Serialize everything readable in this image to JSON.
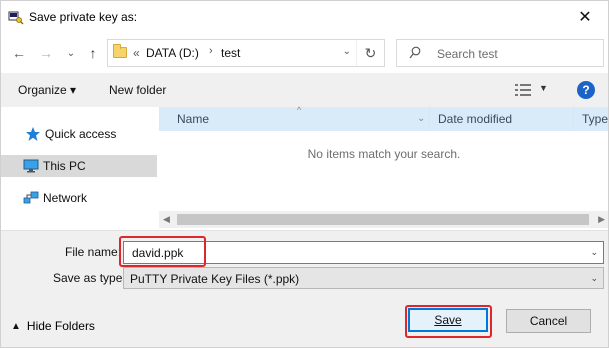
{
  "window": {
    "title": "Save private key as:",
    "close_glyph": "✕"
  },
  "nav": {
    "back_glyph": "←",
    "forward_glyph": "→",
    "recent_glyph": "⌄",
    "up_glyph": "↑"
  },
  "address": {
    "overflow": "«",
    "drive": "DATA (D:)",
    "separator": "›",
    "folder": "test",
    "dropdown_glyph": "⌄",
    "refresh_glyph": "↻"
  },
  "search": {
    "placeholder": "Search test"
  },
  "toolbar": {
    "organize_label": "Organize ▾",
    "new_folder_label": "New folder",
    "view_caret": "▼",
    "help_label": "?"
  },
  "sidebar": {
    "items": [
      {
        "label": "Quick access",
        "icon": "star-icon"
      },
      {
        "label": "This PC",
        "icon": "computer-icon",
        "selected": true
      },
      {
        "label": "Network",
        "icon": "network-icon"
      }
    ]
  },
  "filelist": {
    "columns": [
      "Name",
      "Date modified",
      "Type"
    ],
    "sort_glyph": "^",
    "column_caret": "⌄",
    "empty_message": "No items match your search.",
    "scroll_left": "◀",
    "scroll_right": "▶"
  },
  "form": {
    "filename_label": "File name:",
    "filename_value": "david.ppk",
    "savetype_label": "Save as type:",
    "savetype_value": "PuTTY Private Key Files (*.ppk)",
    "caret": "⌄"
  },
  "footer": {
    "hide_folders_caret": "▲",
    "hide_folders_label": "Hide Folders",
    "save_label": "Save",
    "cancel_label": "Cancel"
  },
  "colors": {
    "accent": "#0078d7",
    "highlight": "#e0262d",
    "header_bg": "#d9ebf9",
    "help_bg": "#1a64c8"
  }
}
